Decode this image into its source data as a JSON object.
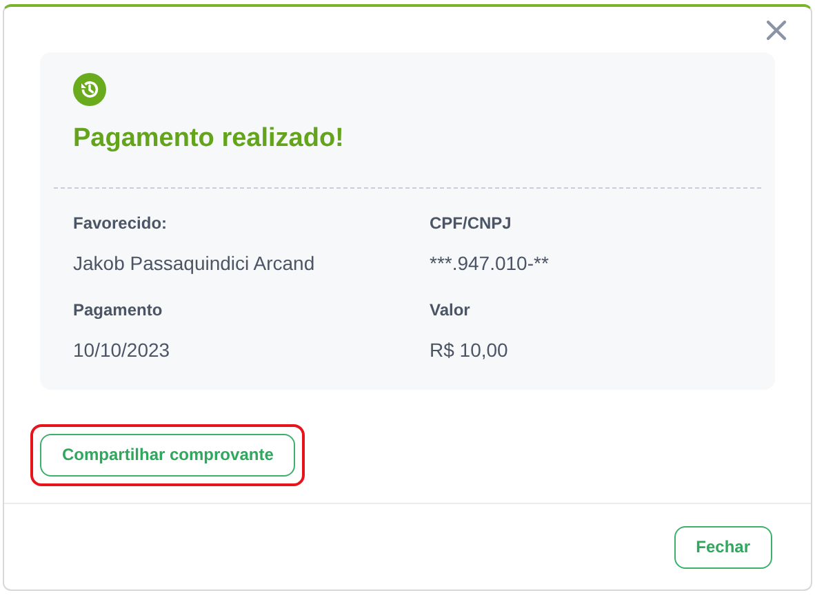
{
  "dialog": {
    "title": "Pagamento realizado!"
  },
  "fields": [
    {
      "label": "Favorecido:",
      "value": "Jakob Passaquindici Arcand"
    },
    {
      "label": "CPF/CNPJ",
      "value": "***.947.010-**"
    },
    {
      "label": "Pagamento",
      "value": "10/10/2023"
    },
    {
      "label": "Valor",
      "value": "R$ 10,00"
    }
  ],
  "share_button": {
    "label": "Compartilhar comprovante",
    "highlighted": true
  },
  "footer": {
    "close_button": "Fechar"
  }
}
